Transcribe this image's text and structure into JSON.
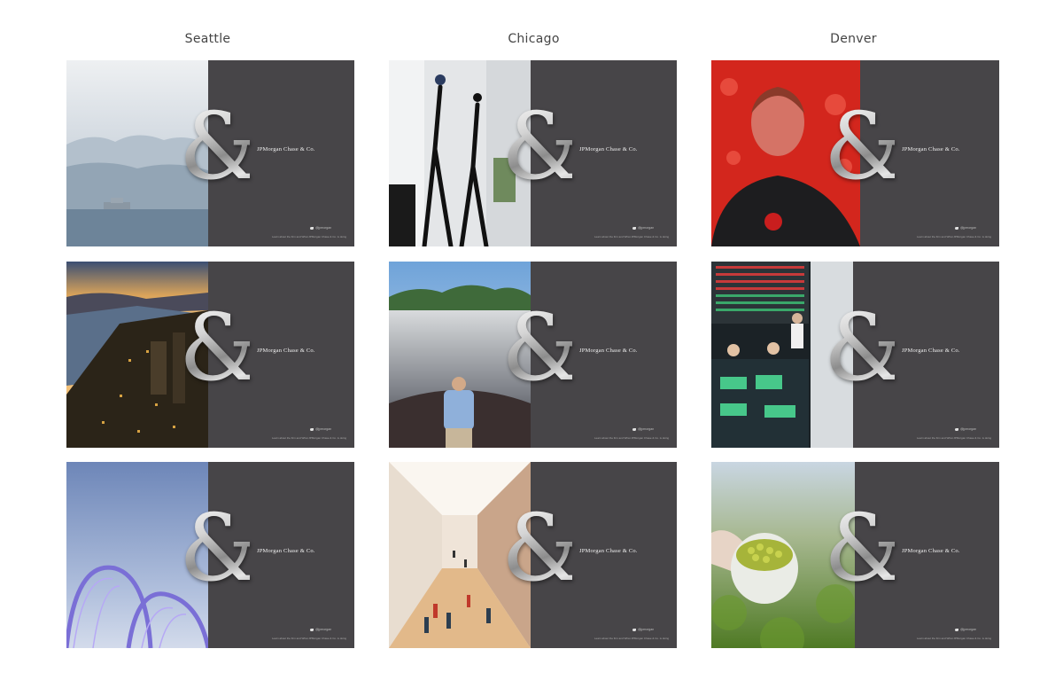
{
  "columns": [
    {
      "title": "Seattle"
    },
    {
      "title": "Chicago"
    },
    {
      "title": "Denver"
    }
  ],
  "card": {
    "ampersand": "&",
    "brand": "JPMorgan Chase & Co.",
    "twitter_handle": "@jpmorgan",
    "footer": "Learn about the firm and What JPMorgan Chase & Co. is doing"
  },
  "photos": [
    "seattle-harbor-fog",
    "seattle-skyline-dusk",
    "seattle-pacific-science-arches",
    "chicago-giacometti-sculptures",
    "chicago-cloud-gate-reflection",
    "chicago-art-institute-gallery",
    "denver-man-red-light",
    "denver-trading-floor",
    "denver-green-peas-scoop"
  ],
  "colors": {
    "card_bg": "#474548",
    "title_text": "#444444"
  }
}
